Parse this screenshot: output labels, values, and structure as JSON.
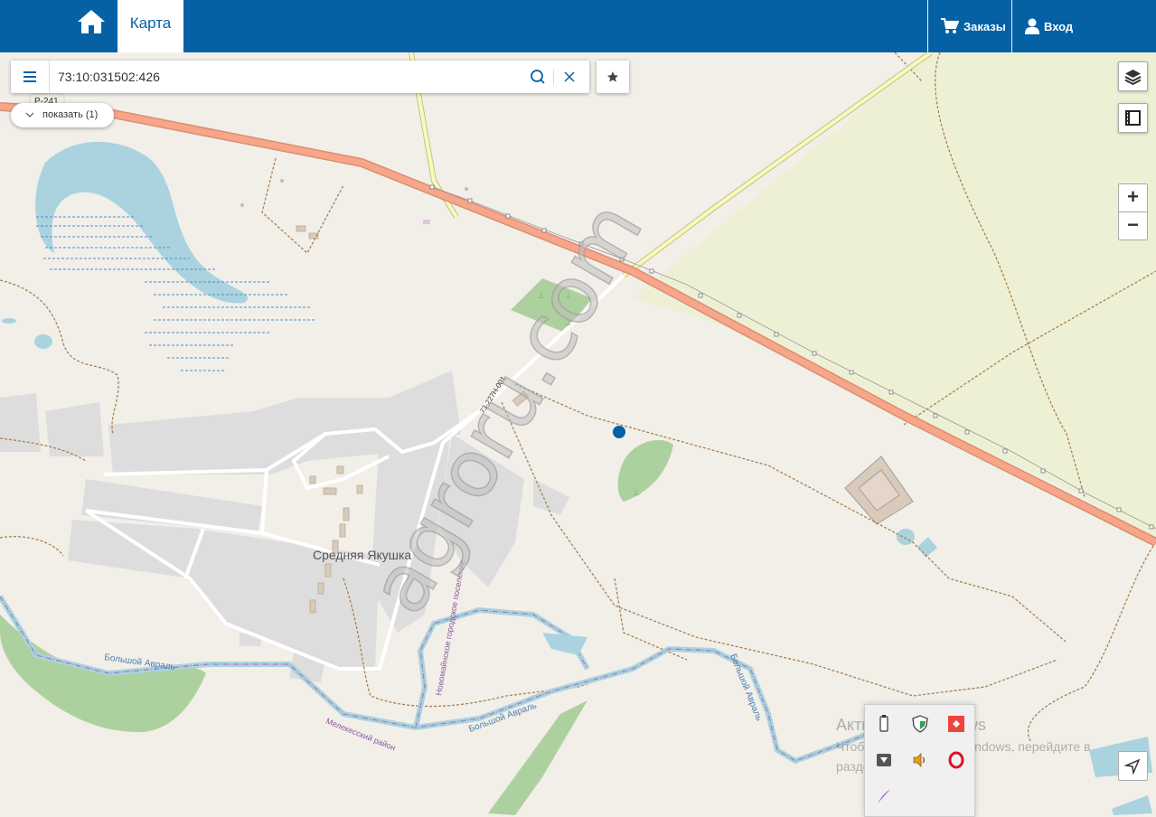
{
  "header": {
    "home_icon": "home-icon",
    "tab_label": "Карта",
    "orders_label": "Заказы",
    "login_label": "Вход"
  },
  "search": {
    "value": "73:10:031502:426",
    "show_label": "показать (1)"
  },
  "map": {
    "road_label": "Р-241",
    "road2_label": "73-227Н-001",
    "village_label": "Средняя Якушка",
    "river1_label": "Большой Авраль",
    "river2_label": "Большой Авраль",
    "river3_label": "Большой Авраль",
    "settlement_label": "Новомайнское городское поселение",
    "district_label": "Мелекесский район",
    "marker_color": "#0561a4"
  },
  "controls": {
    "zoom_in": "+",
    "zoom_out": "−"
  },
  "watermark": "agroru.com",
  "activation": {
    "line1": "Активация Windows",
    "line2": "Чтобы активировать Windows, перейдите в",
    "line3": "раздел \"Параметры\"."
  }
}
